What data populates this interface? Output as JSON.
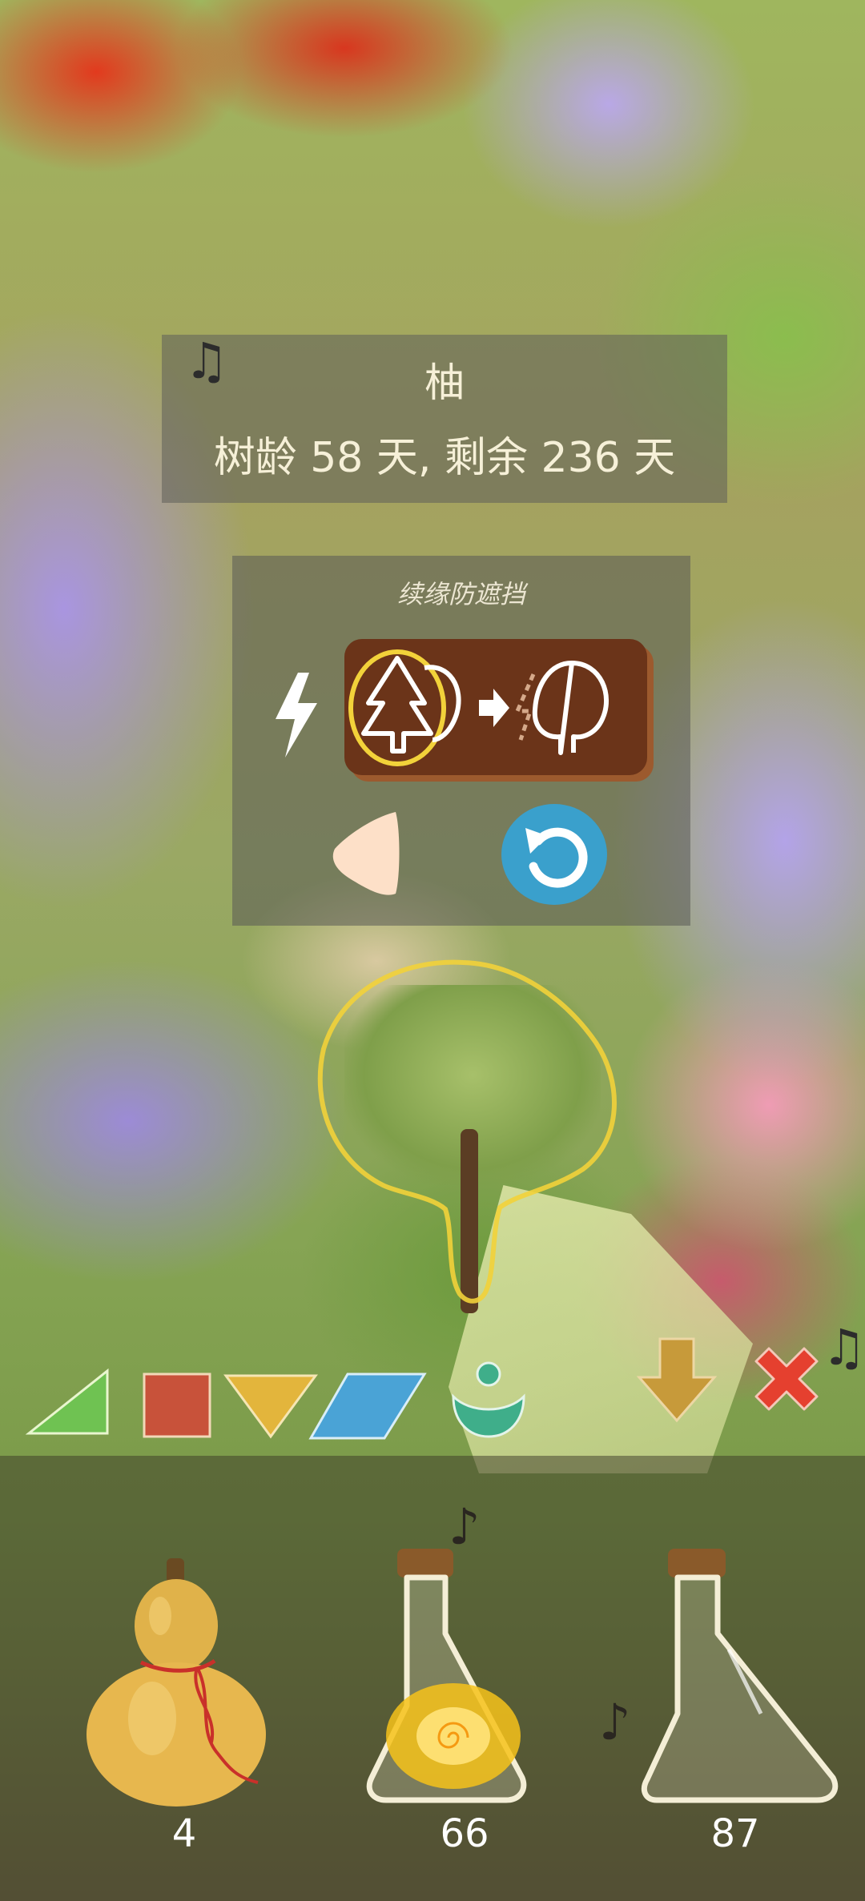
{
  "tree_info": {
    "name": "柚",
    "age_text": "树龄 58 天, 剩余 236 天"
  },
  "action_panel": {
    "title": "续缘防遮挡"
  },
  "inventory": {
    "items": [
      {
        "name": "gourd",
        "count": "4"
      },
      {
        "name": "glowing-potion",
        "count": "66"
      },
      {
        "name": "empty-potion",
        "count": "87"
      }
    ]
  },
  "colors": {
    "panel_overlay": "#5f5f5a",
    "swap_button": "#6b3419",
    "reset_button": "#3aa0cc",
    "outline_yellow": "#f2d23a",
    "triangle_green": "#6fc252",
    "square_red": "#c8523a",
    "triangle_yellow": "#e3b53c",
    "parallelogram_blue": "#4aa3d6",
    "sprout_green": "#3fae8a",
    "arrow_gold": "#c79a3a",
    "cross_red": "#e5402f"
  },
  "icons": [
    "music-note-icon",
    "lightning-icon",
    "tree-swap-icon",
    "back-arrow-icon",
    "reset-icon",
    "triangle-tool-icon",
    "square-tool-icon",
    "inverted-triangle-tool-icon",
    "parallelogram-tool-icon",
    "sprout-tool-icon",
    "down-arrow-icon",
    "close-icon"
  ]
}
